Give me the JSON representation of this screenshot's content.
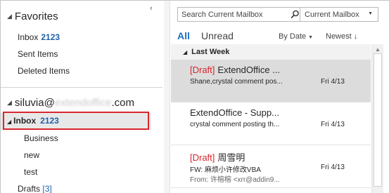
{
  "folder_pane": {
    "collapse_icon": "chevron-left-icon",
    "favorites": {
      "header": "Favorites",
      "items": [
        {
          "label": "Inbox",
          "count": "2123"
        },
        {
          "label": "Sent Items"
        },
        {
          "label": "Deleted Items"
        }
      ]
    },
    "account": {
      "prefix": "siluvia@",
      "blurred": "extendoffice",
      "suffix": ".com"
    },
    "inbox": {
      "label": "Inbox",
      "count": "2123"
    },
    "subfolders": [
      "Business",
      "new",
      "test"
    ],
    "drafts": {
      "label": "Drafts",
      "count": "[3]"
    }
  },
  "list_pane": {
    "search": {
      "placeholder": "Search Current Mailbox",
      "icon": "search-icon"
    },
    "scope": {
      "value": "Current Mailbox"
    },
    "tabs": {
      "all": "All",
      "unread": "Unread"
    },
    "sort": {
      "by": "By Date",
      "order": "Newest"
    },
    "group_header": "Last Week",
    "messages": [
      {
        "draft": "[Draft]",
        "sender": "ExtendOffice ...",
        "subject": "Shane,crystal comment pos...",
        "from": "",
        "date": "Fri 4/13"
      },
      {
        "draft": "",
        "sender": "ExtendOffice - Supp...",
        "subject": "crystal comment posting th...",
        "from": "",
        "date": "Fri 4/13"
      },
      {
        "draft": "[Draft]",
        "sender": "周雪明",
        "subject": "FW: 麻烦小许修改VBA",
        "from": "From: 许榕榕 <xrr@addin9...",
        "date": "Fri 4/13"
      }
    ]
  },
  "colors": {
    "accent_blue": "#1f6fc4",
    "count_blue": "#1f5fa8",
    "draft_red": "#d9262e",
    "highlight_border": "#d9262e",
    "selected_bg": "#dcdcdc"
  }
}
